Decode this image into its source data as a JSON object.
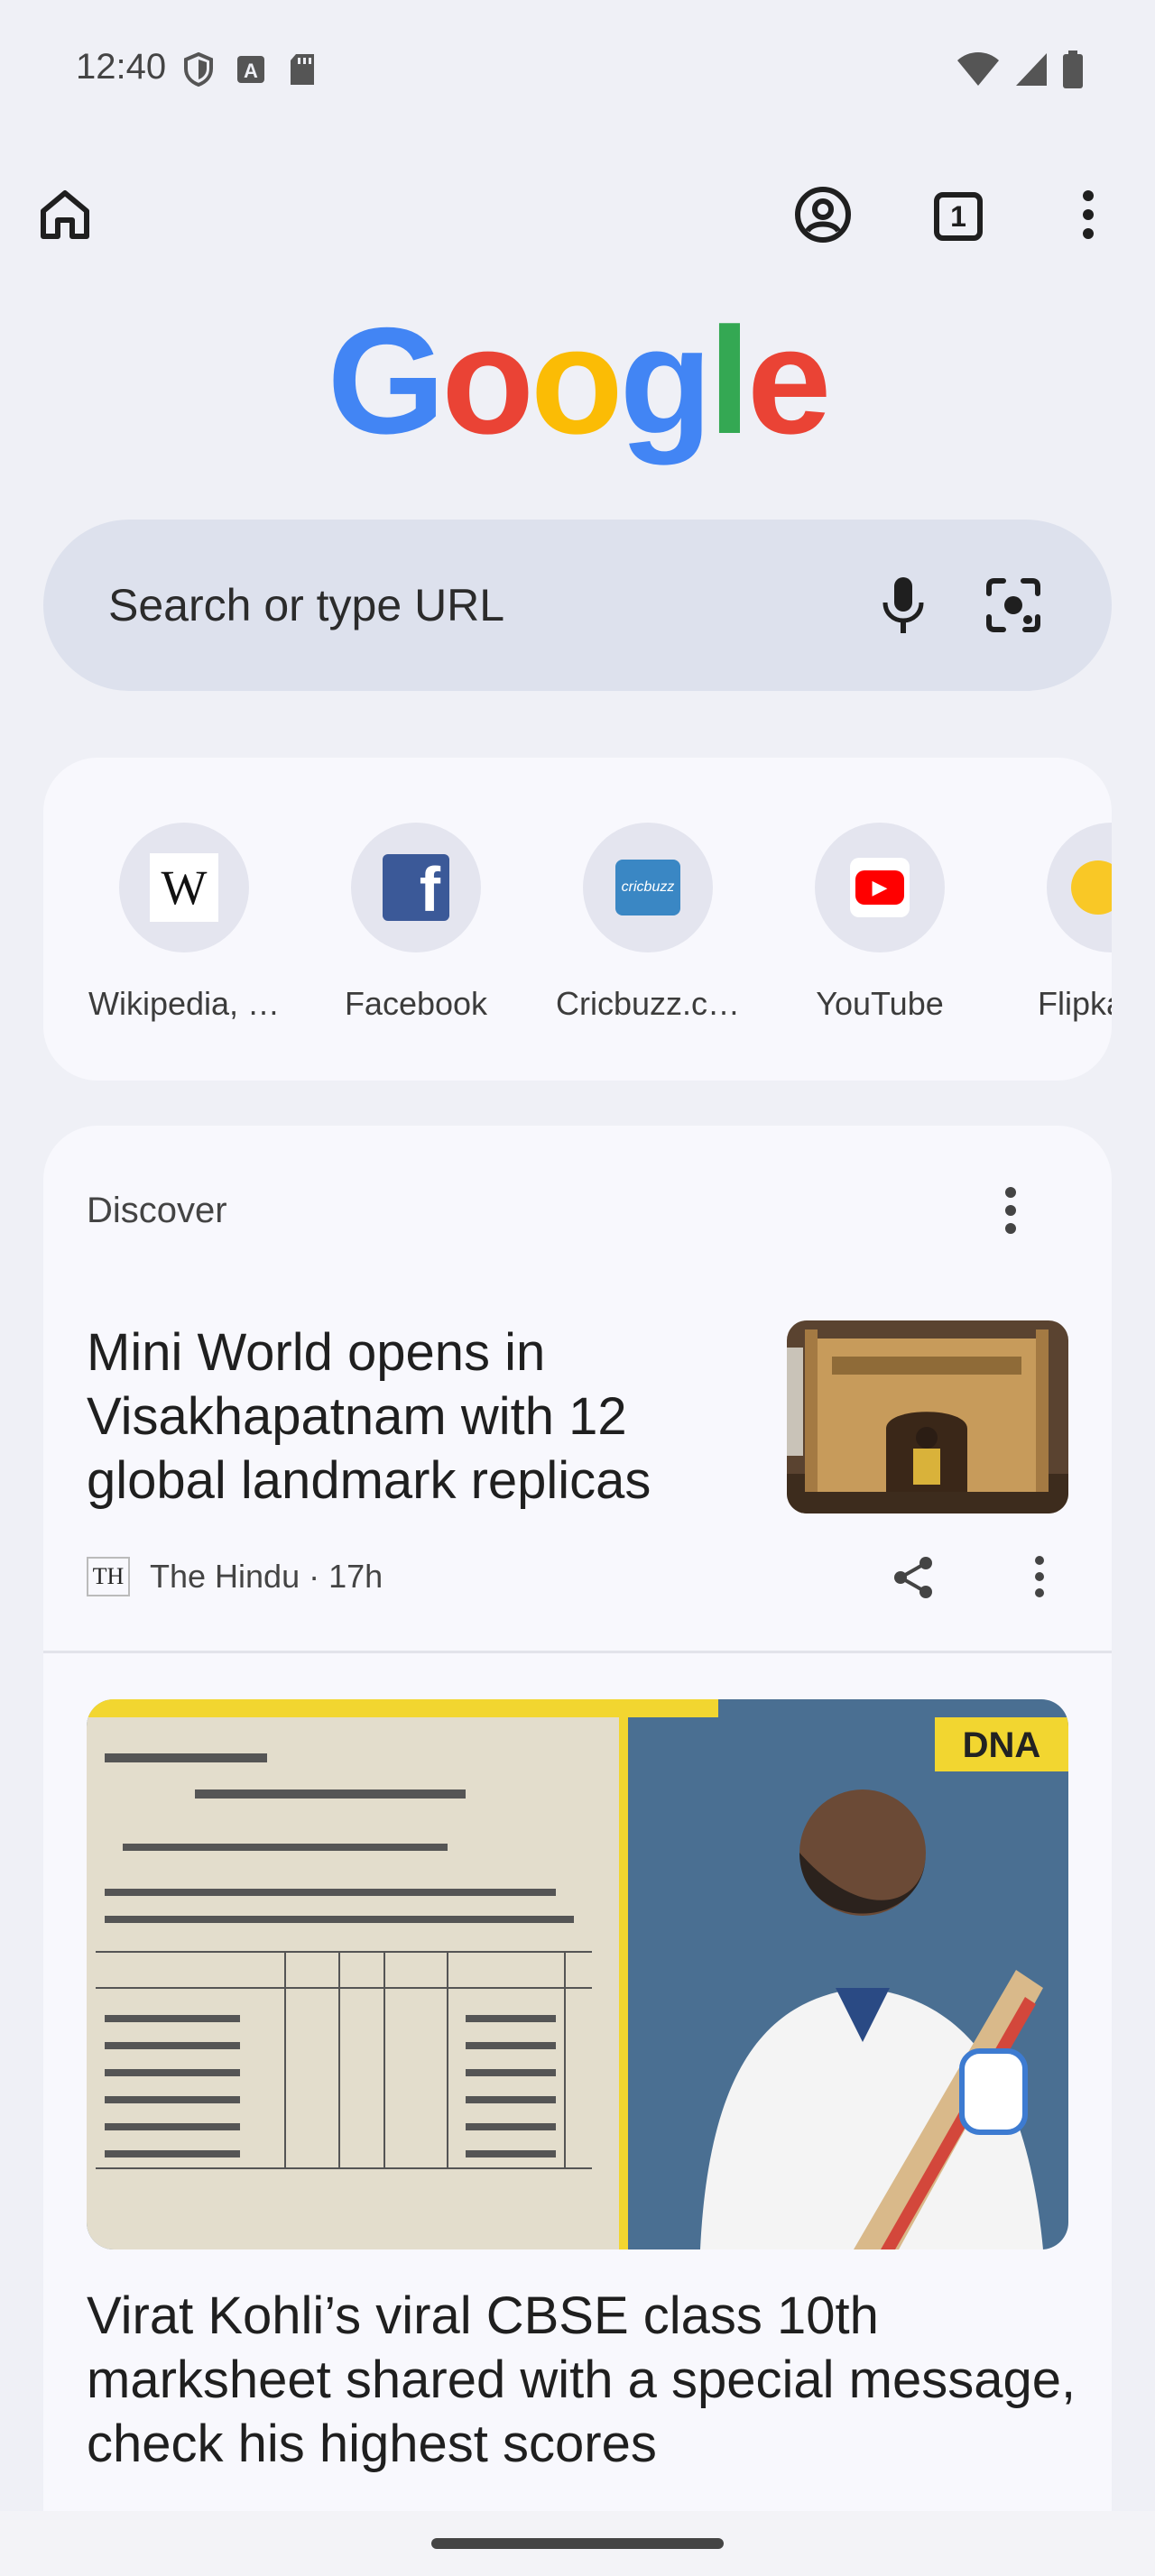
{
  "status_bar": {
    "time": "12:40",
    "left_icons": [
      "shield-icon",
      "a-badge-icon",
      "sd-card-icon"
    ],
    "right_icons": [
      "wifi-icon",
      "signal-icon",
      "battery-icon"
    ]
  },
  "toolbar": {
    "icons": [
      "home-icon",
      "account-icon",
      "tab-switcher-icon",
      "more-vert-icon"
    ],
    "tab_count": "1"
  },
  "logo": {
    "text": "Google",
    "colors": [
      "#4285F4",
      "#EA4335",
      "#FBBC05",
      "#4285F4",
      "#34A853",
      "#EA4335"
    ]
  },
  "search": {
    "placeholder": "Search or type URL",
    "icons": [
      "mic-icon",
      "lens-icon"
    ]
  },
  "shortcuts": [
    {
      "label": "Wikipedia, …",
      "icon": "wikipedia-icon",
      "glyph": "W"
    },
    {
      "label": "Facebook",
      "icon": "facebook-icon",
      "glyph": "f"
    },
    {
      "label": "Cricbuzz.c…",
      "icon": "cricbuzz-icon",
      "glyph": "cricbuzz"
    },
    {
      "label": "YouTube",
      "icon": "youtube-icon",
      "glyph": "▶"
    },
    {
      "label": "Flipka",
      "icon": "flipkart-icon",
      "glyph": ""
    }
  ],
  "discover": {
    "title": "Discover",
    "articles": [
      {
        "title": "Mini World opens in Visakhapatnam with 12 global landmark replicas",
        "source_logo": "TH",
        "meta": "The Hindu · 17h"
      },
      {
        "title": "Virat Kohli’s viral CBSE class 10th marksheet shared with a special message, check his highest scores",
        "image_badge": "DNA"
      }
    ]
  },
  "colors": {
    "page_bg": "#eff0f6",
    "card_bg": "#f8f8fd",
    "search_bg": "#dde1ed"
  }
}
